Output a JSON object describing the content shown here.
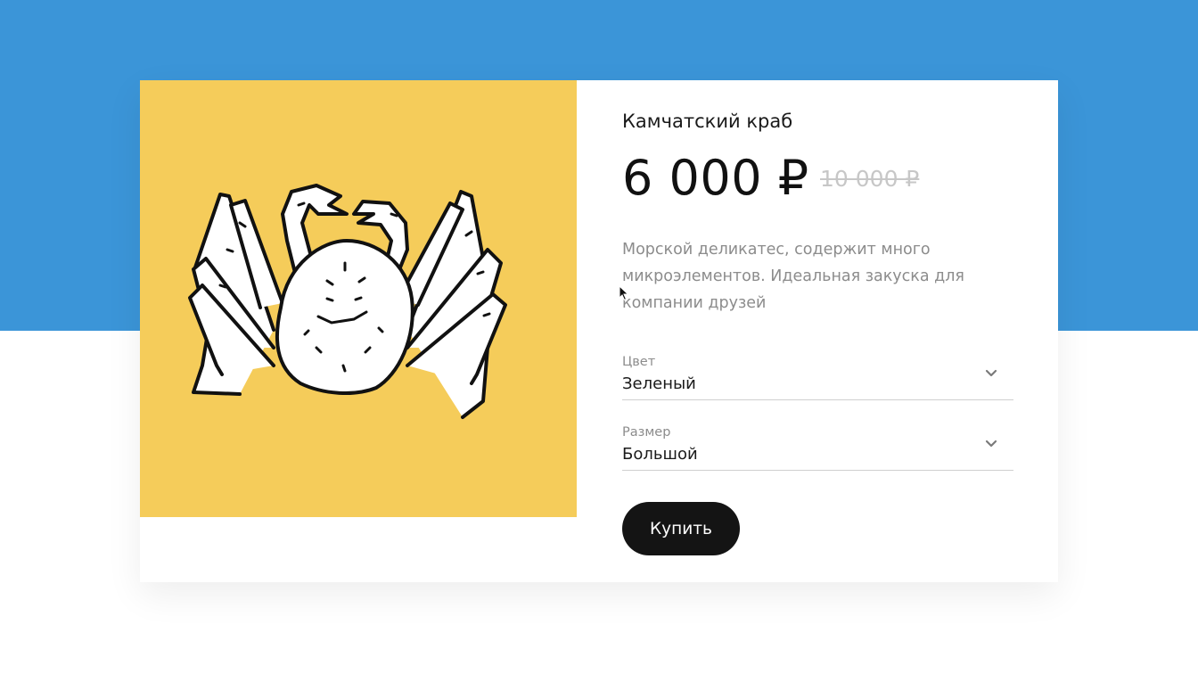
{
  "product": {
    "name": "Камчатский краб",
    "price": "6 000 ₽",
    "old_price": "10 000 ₽",
    "description": "Морской деликатес, содержит много микроэлементов. Идеальная закуска для компании друзей",
    "image_icon": "crab-illustration"
  },
  "options": {
    "color": {
      "label": "Цвет",
      "value": "Зеленый"
    },
    "size": {
      "label": "Размер",
      "value": "Большой"
    }
  },
  "actions": {
    "buy_label": "Купить"
  },
  "colors": {
    "band": "#3b95d8",
    "image_bg": "#f5cc5a",
    "button_bg": "#141414",
    "text_primary": "#111111",
    "text_secondary": "#8c8c8c"
  }
}
